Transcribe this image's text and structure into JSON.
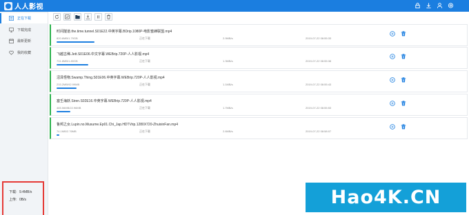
{
  "app": {
    "name": "人人影视"
  },
  "topbar": {
    "icons": [
      "lock-icon",
      "download-icon",
      "user-icon",
      "settings-icon"
    ]
  },
  "sidebar": {
    "items": [
      {
        "label": "正在下载",
        "icon": "download-list-icon",
        "active": true
      },
      {
        "label": "下载完成",
        "icon": "monitor-icon",
        "active": false
      },
      {
        "label": "最新更新",
        "icon": "calendar-icon",
        "active": false
      },
      {
        "label": "我的收藏",
        "icon": "heart-icon",
        "active": false
      }
    ],
    "speed": {
      "download_label": "下载:",
      "download_value": "9.4MB/s",
      "upload_label": "上传:",
      "upload_value": "0B/s"
    }
  },
  "toolbar": {
    "buttons": [
      "refresh-icon",
      "checklist-icon",
      "folder-icon",
      "import-icon",
      "pause-icon",
      "trash-icon"
    ]
  },
  "tasks": [
    {
      "name": "时间隧道.the.time.tunnel.S01E22.中英字幕.BDrip.1080P-电影蜜蜂联盟.mp4",
      "size": "820.6MB/1.79GB",
      "status": "正在下载",
      "speed": "2.9MB/s",
      "time": "2019-07-22 08:55:33",
      "progress": 0.45
    },
    {
      "name": "飞越古稀.Jett.S01E06.中文字幕.WEBrip.720P-人人影视.mp4",
      "size": "731.8MB/1.89GB",
      "status": "正在下载",
      "speed": "1.3MB/s",
      "time": "2019-07-22 08:55:38",
      "progress": 0.38
    },
    {
      "name": "沼泽怪物.Swamp.Thing.S01E06.中英字幕.WEBrip.720P-人人影视.mp4",
      "size": "233.2MB/92.99MB",
      "status": "正在下载",
      "speed": "1.1MB/s",
      "time": "2019-07-22 08:55:43",
      "progress": 0.24
    },
    {
      "name": "塞壬海妖.Siren.S02E16.中英字幕.WEBrip.720P-人人影视.mp4",
      "size": "465.56MB/22.96MB",
      "status": "正在下载",
      "speed": "1.7MB/s",
      "time": "2019-07-22 08:55:53",
      "progress": 0.16
    },
    {
      "name": "鲁邦之女.Lupin.no.Musume.Ep01.Chi_Jap.HDTVrip.1280X720-ZhuixinFan.mp4",
      "size": "74.1MB/2.76MB",
      "status": "正在下载",
      "speed": "2.6MB/s",
      "time": "2019-07-22 08:58:07",
      "progress": 0.03
    }
  ],
  "watermark": {
    "text": "Hao4K.CN"
  },
  "colors": {
    "accent": "#1b7ee0",
    "task_marker": "#2bb24c",
    "highlight_box": "#e53935",
    "watermark_bg": "#14a0d8"
  }
}
